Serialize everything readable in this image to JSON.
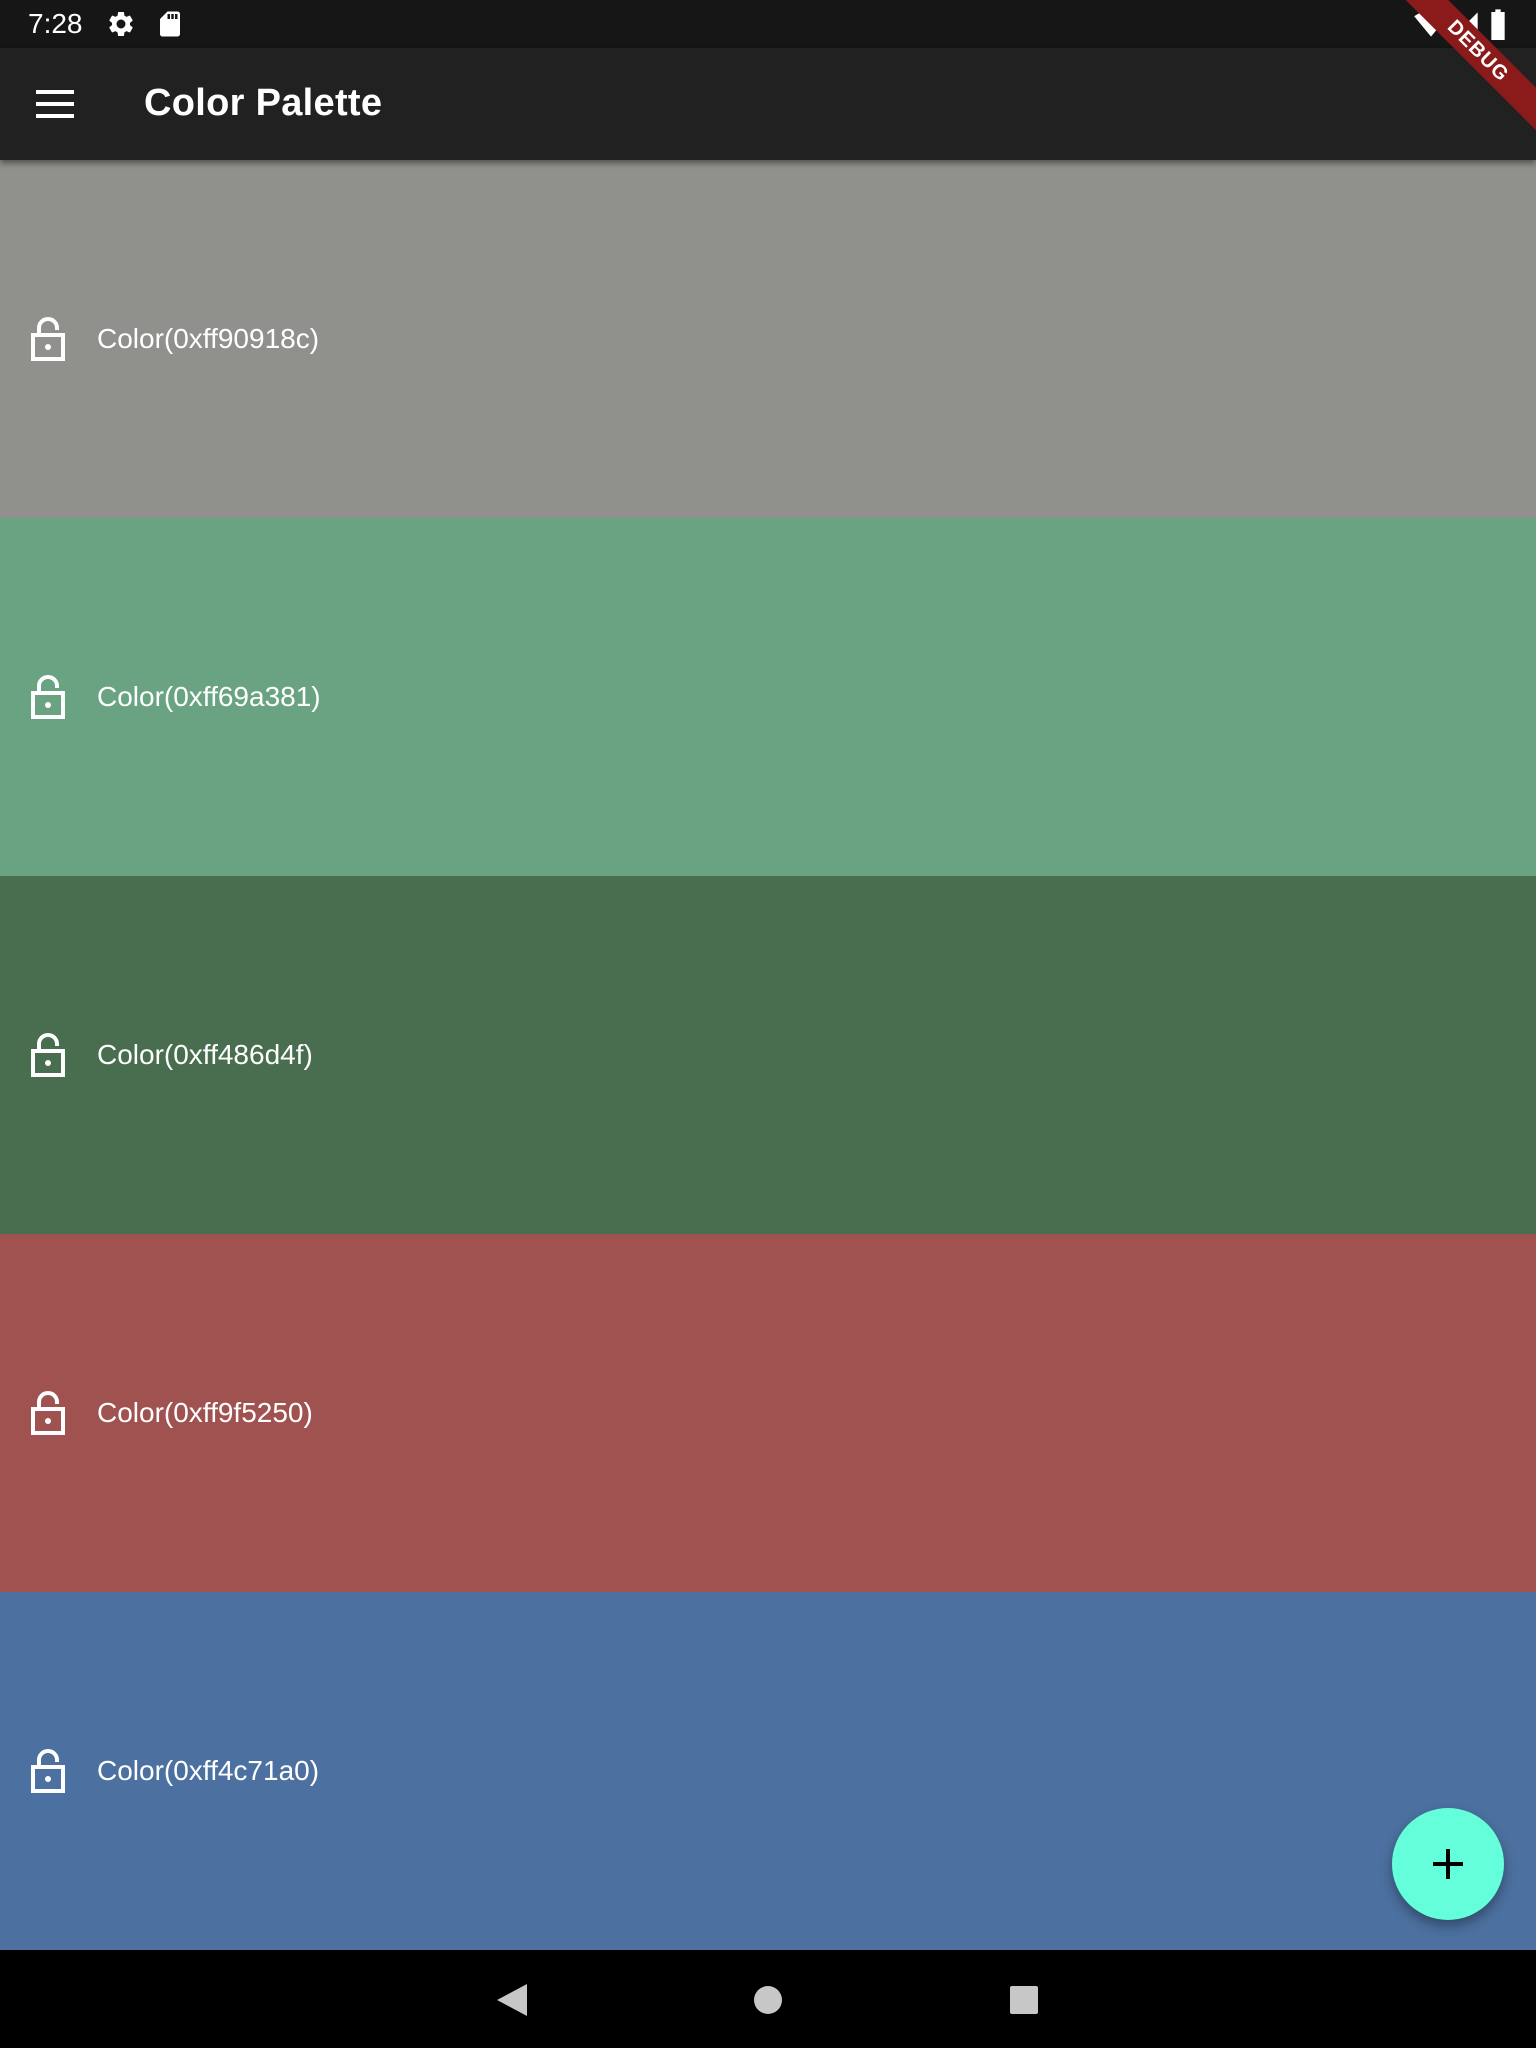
{
  "status_bar": {
    "time": "7:28",
    "icons": [
      "settings-icon",
      "sd-card-icon",
      "wifi-icon",
      "signal-icon",
      "battery-icon"
    ]
  },
  "app_bar": {
    "title": "Color Palette",
    "menu_icon": "menu-icon"
  },
  "debug_banner": {
    "label": "DEBUG"
  },
  "palette": [
    {
      "label": "Color(0xff90918c)",
      "hex": "#90918c",
      "icon": "lock-open-icon"
    },
    {
      "label": "Color(0xff69a381)",
      "hex": "#69a381",
      "icon": "lock-open-icon"
    },
    {
      "label": "Color(0xff486d4f)",
      "hex": "#486d4f",
      "icon": "lock-open-icon"
    },
    {
      "label": "Color(0xff9f5250)",
      "hex": "#9f5250",
      "icon": "lock-open-icon"
    },
    {
      "label": "Color(0xff4c71a0)",
      "hex": "#4c71a0",
      "icon": "lock-open-icon"
    }
  ],
  "fab": {
    "icon": "add-icon",
    "color": "#64ffda"
  },
  "nav_bar": {
    "buttons": [
      "back-icon",
      "home-icon",
      "recents-icon"
    ]
  }
}
